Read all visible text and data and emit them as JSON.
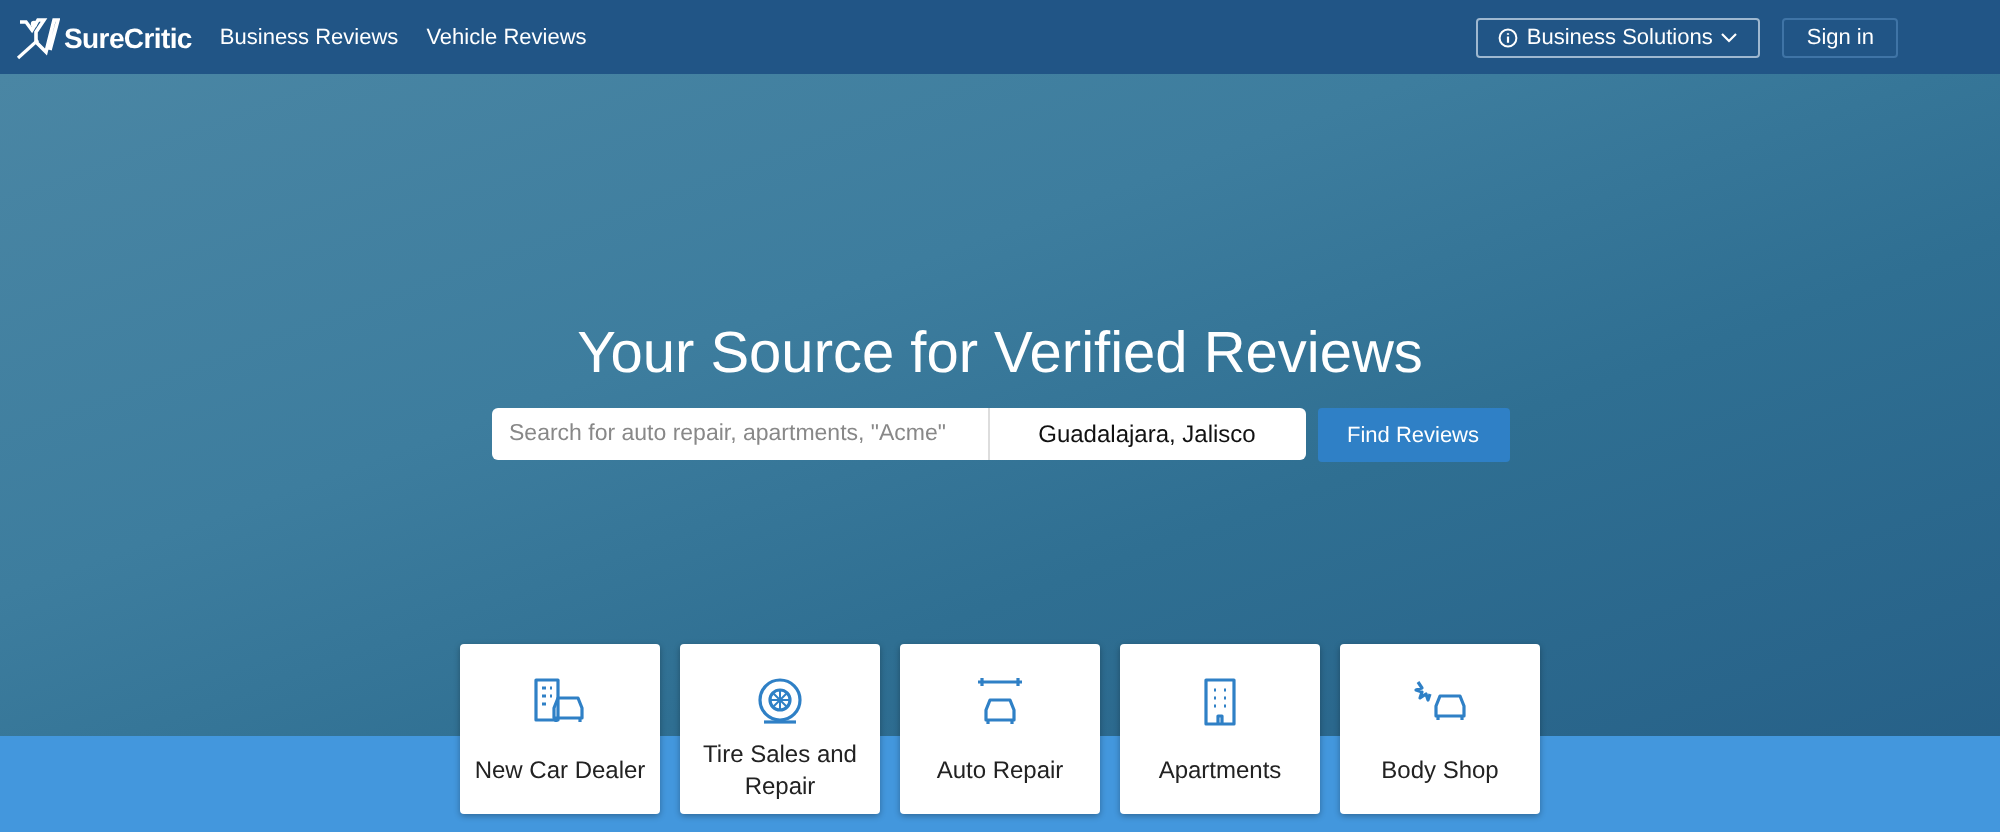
{
  "nav": {
    "logo": "SureCritic",
    "links": [
      "Business Reviews",
      "Vehicle Reviews"
    ],
    "business_solutions": "Business Solutions",
    "sign_in": "Sign in"
  },
  "hero": {
    "title": "Your Source for Verified Reviews",
    "search": {
      "placeholder": "Search for auto repair, apartments, \"Acme\""
    },
    "location": {
      "value": "Guadalajara, Jalisco"
    },
    "button": "Find Reviews"
  },
  "categories": [
    {
      "label": "New Car Dealer",
      "kind": "dealer"
    },
    {
      "label": "Tire Sales and Repair",
      "kind": "tire"
    },
    {
      "label": "Auto Repair",
      "kind": "repair"
    },
    {
      "label": "Apartments",
      "kind": "building"
    },
    {
      "label": "Body Shop",
      "kind": "collision"
    }
  ]
}
